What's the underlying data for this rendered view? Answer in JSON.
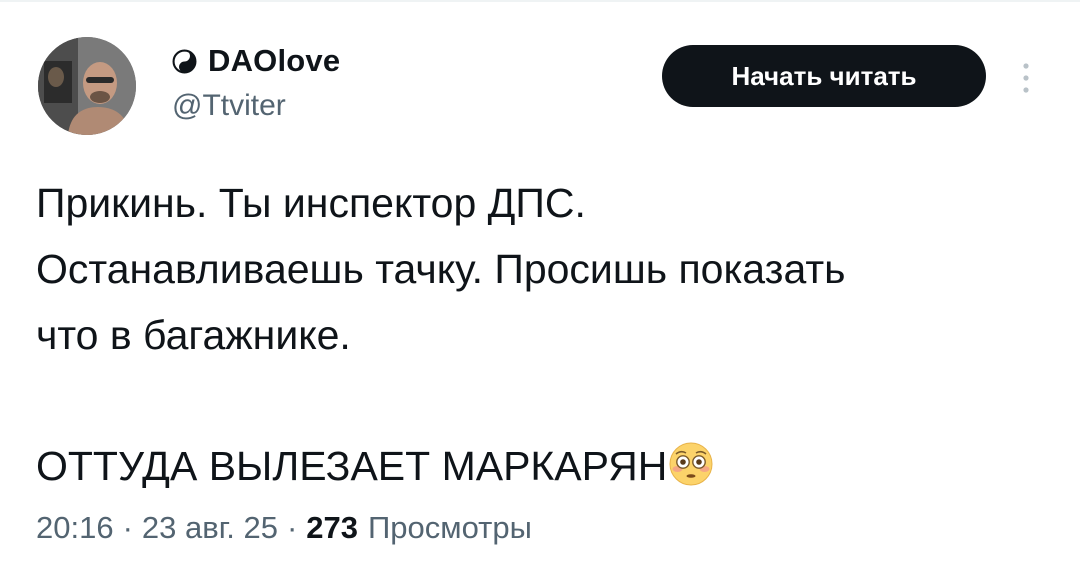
{
  "author": {
    "display_name": "DAOlove",
    "handle": "@Ttviter",
    "badge_icon": "yin-yang-icon"
  },
  "actions": {
    "follow_label": "Начать читать",
    "more_icon": "more-vertical-icon"
  },
  "tweet": {
    "lines": [
      "Прикинь. Ты инспектор ДПС.",
      "Останавливаешь тачку. Просишь показать",
      "что в багажнике.",
      "ОТТУДА ВЫЛЕЗАЕТ МАРКАРЯН"
    ],
    "emoji": "flushed-face-emoji"
  },
  "meta": {
    "time": "20:16",
    "separator": "·",
    "date": "23 авг. 25",
    "views_count": "273",
    "views_label": "Просмотры"
  },
  "colors": {
    "text_primary": "#0f1419",
    "text_secondary": "#536471",
    "button_bg": "#0f1419",
    "button_text": "#ffffff",
    "divider": "#eff3f4"
  }
}
